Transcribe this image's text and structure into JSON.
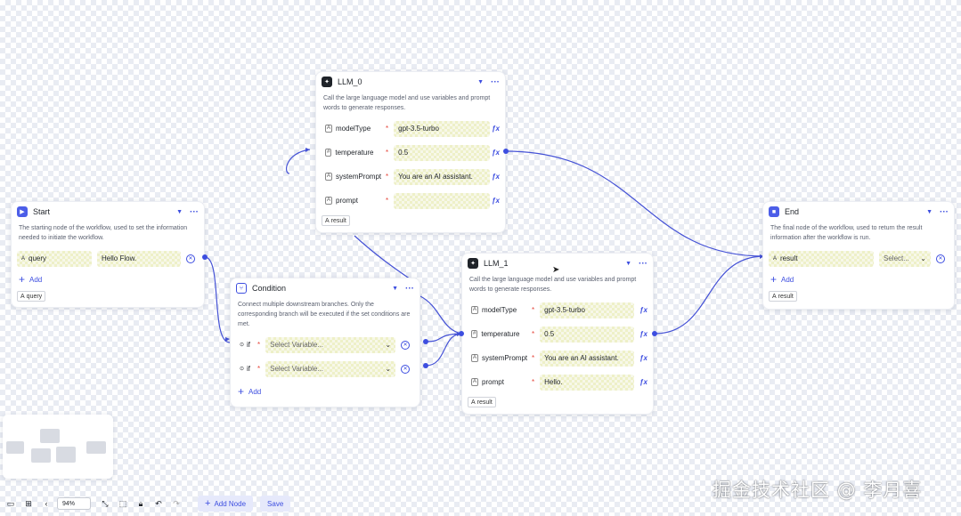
{
  "colors": {
    "accent": "#3d4ee0",
    "required": "#e5483d",
    "edge": "#4552d6"
  },
  "nodes": {
    "llm0": {
      "title": "LLM_0",
      "description": "Call the large language model and use variables and prompt words to generate responses.",
      "params": [
        {
          "name": "modelType",
          "value": "gpt-3.5-turbo"
        },
        {
          "name": "temperature",
          "value": "0.5"
        },
        {
          "name": "systemPrompt",
          "value": "You are an AI assistant."
        },
        {
          "name": "prompt",
          "value": ""
        }
      ],
      "output": "result"
    },
    "start": {
      "title": "Start",
      "description": "The starting node of the workflow, used to set the information needed to initiate the workflow.",
      "params": [
        {
          "name": "query",
          "value": "Hello Flow."
        }
      ],
      "add_label": "Add",
      "output": "query"
    },
    "condition": {
      "title": "Condition",
      "description": "Connect multiple downstream branches. Only the corresponding branch will be executed if the set conditions are met.",
      "branches": [
        {
          "label": "if",
          "placeholder": "Select Variable..."
        },
        {
          "label": "if",
          "placeholder": "Select Variable..."
        }
      ],
      "add_label": "Add"
    },
    "llm1": {
      "title": "LLM_1",
      "description": "Call the large language model and use variables and prompt words to generate responses.",
      "params": [
        {
          "name": "modelType",
          "value": "gpt-3.5-turbo"
        },
        {
          "name": "temperature",
          "value": "0.5"
        },
        {
          "name": "systemPrompt",
          "value": "You are an AI assistant."
        },
        {
          "name": "prompt",
          "value": "Hello."
        }
      ],
      "output": "result"
    },
    "end": {
      "title": "End",
      "description": "The final node of the workflow, used to return the result information after the workflow is run.",
      "params": [
        {
          "name": "result",
          "value": "Select..."
        }
      ],
      "add_label": "Add",
      "output": "result"
    }
  },
  "toolbar": {
    "zoom": "94%",
    "add_node_label": "Add Node",
    "save_label": "Save"
  },
  "watermark": "掘金技术社区 @ 李月喜"
}
